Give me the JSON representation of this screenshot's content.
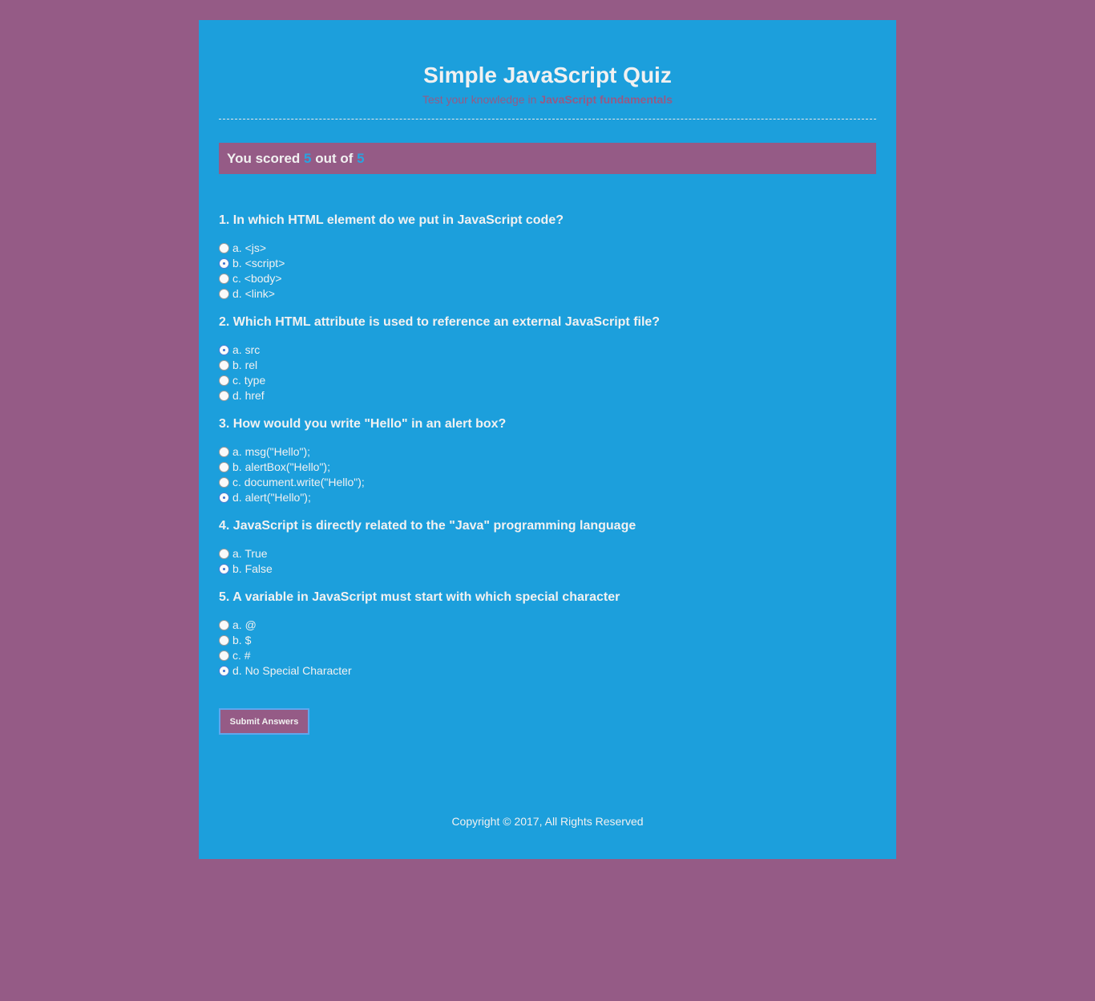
{
  "header": {
    "title": "Simple JavaScript Quiz",
    "subtitle_prefix": "Test your knowledge in ",
    "subtitle_bold": "JavaScript fundamentals"
  },
  "score": {
    "prefix": "You scored ",
    "correct": "5",
    "middle": " out of ",
    "total": "5"
  },
  "questions": [
    {
      "title": "1. In which HTML element do we put in JavaScript code?",
      "selected": 1,
      "answers": [
        "a. <js>",
        "b. <script>",
        "c. <body>",
        "d. <link>"
      ]
    },
    {
      "title": "2. Which HTML attribute is used to reference an external JavaScript file?",
      "selected": 0,
      "answers": [
        "a. src",
        "b. rel",
        "c. type",
        "d. href"
      ]
    },
    {
      "title": "3. How would you write \"Hello\" in an alert box?",
      "selected": 3,
      "answers": [
        "a. msg(\"Hello\");",
        "b. alertBox(\"Hello\");",
        "c. document.write(\"Hello\");",
        "d. alert(\"Hello\");"
      ]
    },
    {
      "title": "4. JavaScript is directly related to the \"Java\" programming language",
      "selected": 1,
      "answers": [
        "a. True",
        "b. False"
      ]
    },
    {
      "title": "5. A variable in JavaScript must start with which special character",
      "selected": 3,
      "answers": [
        "a. @",
        "b. $",
        "c. #",
        "d. No Special Character"
      ]
    }
  ],
  "submit_label": "Submit Answers",
  "footer": "Copyright © 2017, All Rights Reserved",
  "colors": {
    "page_background": "#955b86",
    "container_background": "#1c9fdc",
    "score_number": "#2aa3df",
    "text": "#f1f1f1"
  }
}
